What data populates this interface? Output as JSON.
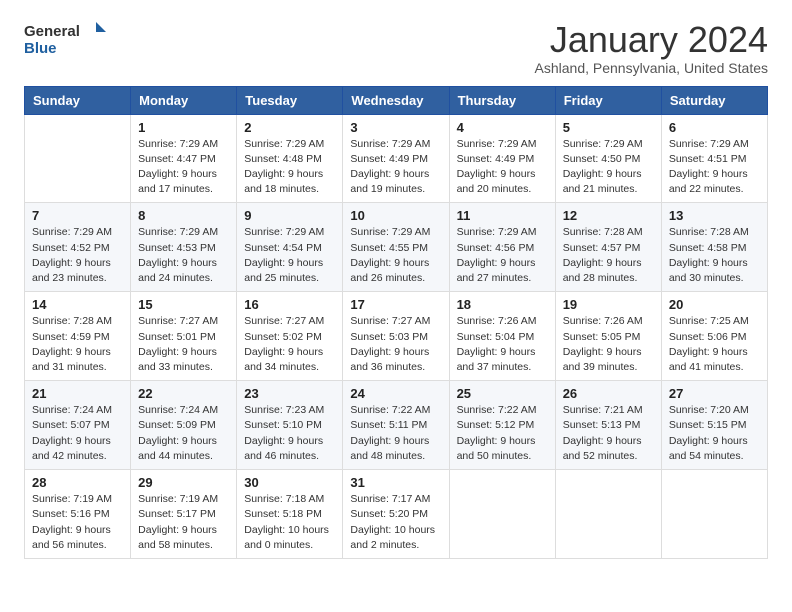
{
  "header": {
    "logo_general": "General",
    "logo_blue": "Blue",
    "month_title": "January 2024",
    "location": "Ashland, Pennsylvania, United States"
  },
  "weekdays": [
    "Sunday",
    "Monday",
    "Tuesday",
    "Wednesday",
    "Thursday",
    "Friday",
    "Saturday"
  ],
  "weeks": [
    [
      {
        "day": "",
        "info": ""
      },
      {
        "day": "1",
        "info": "Sunrise: 7:29 AM\nSunset: 4:47 PM\nDaylight: 9 hours\nand 17 minutes."
      },
      {
        "day": "2",
        "info": "Sunrise: 7:29 AM\nSunset: 4:48 PM\nDaylight: 9 hours\nand 18 minutes."
      },
      {
        "day": "3",
        "info": "Sunrise: 7:29 AM\nSunset: 4:49 PM\nDaylight: 9 hours\nand 19 minutes."
      },
      {
        "day": "4",
        "info": "Sunrise: 7:29 AM\nSunset: 4:49 PM\nDaylight: 9 hours\nand 20 minutes."
      },
      {
        "day": "5",
        "info": "Sunrise: 7:29 AM\nSunset: 4:50 PM\nDaylight: 9 hours\nand 21 minutes."
      },
      {
        "day": "6",
        "info": "Sunrise: 7:29 AM\nSunset: 4:51 PM\nDaylight: 9 hours\nand 22 minutes."
      }
    ],
    [
      {
        "day": "7",
        "info": "Sunrise: 7:29 AM\nSunset: 4:52 PM\nDaylight: 9 hours\nand 23 minutes."
      },
      {
        "day": "8",
        "info": "Sunrise: 7:29 AM\nSunset: 4:53 PM\nDaylight: 9 hours\nand 24 minutes."
      },
      {
        "day": "9",
        "info": "Sunrise: 7:29 AM\nSunset: 4:54 PM\nDaylight: 9 hours\nand 25 minutes."
      },
      {
        "day": "10",
        "info": "Sunrise: 7:29 AM\nSunset: 4:55 PM\nDaylight: 9 hours\nand 26 minutes."
      },
      {
        "day": "11",
        "info": "Sunrise: 7:29 AM\nSunset: 4:56 PM\nDaylight: 9 hours\nand 27 minutes."
      },
      {
        "day": "12",
        "info": "Sunrise: 7:28 AM\nSunset: 4:57 PM\nDaylight: 9 hours\nand 28 minutes."
      },
      {
        "day": "13",
        "info": "Sunrise: 7:28 AM\nSunset: 4:58 PM\nDaylight: 9 hours\nand 30 minutes."
      }
    ],
    [
      {
        "day": "14",
        "info": "Sunrise: 7:28 AM\nSunset: 4:59 PM\nDaylight: 9 hours\nand 31 minutes."
      },
      {
        "day": "15",
        "info": "Sunrise: 7:27 AM\nSunset: 5:01 PM\nDaylight: 9 hours\nand 33 minutes."
      },
      {
        "day": "16",
        "info": "Sunrise: 7:27 AM\nSunset: 5:02 PM\nDaylight: 9 hours\nand 34 minutes."
      },
      {
        "day": "17",
        "info": "Sunrise: 7:27 AM\nSunset: 5:03 PM\nDaylight: 9 hours\nand 36 minutes."
      },
      {
        "day": "18",
        "info": "Sunrise: 7:26 AM\nSunset: 5:04 PM\nDaylight: 9 hours\nand 37 minutes."
      },
      {
        "day": "19",
        "info": "Sunrise: 7:26 AM\nSunset: 5:05 PM\nDaylight: 9 hours\nand 39 minutes."
      },
      {
        "day": "20",
        "info": "Sunrise: 7:25 AM\nSunset: 5:06 PM\nDaylight: 9 hours\nand 41 minutes."
      }
    ],
    [
      {
        "day": "21",
        "info": "Sunrise: 7:24 AM\nSunset: 5:07 PM\nDaylight: 9 hours\nand 42 minutes."
      },
      {
        "day": "22",
        "info": "Sunrise: 7:24 AM\nSunset: 5:09 PM\nDaylight: 9 hours\nand 44 minutes."
      },
      {
        "day": "23",
        "info": "Sunrise: 7:23 AM\nSunset: 5:10 PM\nDaylight: 9 hours\nand 46 minutes."
      },
      {
        "day": "24",
        "info": "Sunrise: 7:22 AM\nSunset: 5:11 PM\nDaylight: 9 hours\nand 48 minutes."
      },
      {
        "day": "25",
        "info": "Sunrise: 7:22 AM\nSunset: 5:12 PM\nDaylight: 9 hours\nand 50 minutes."
      },
      {
        "day": "26",
        "info": "Sunrise: 7:21 AM\nSunset: 5:13 PM\nDaylight: 9 hours\nand 52 minutes."
      },
      {
        "day": "27",
        "info": "Sunrise: 7:20 AM\nSunset: 5:15 PM\nDaylight: 9 hours\nand 54 minutes."
      }
    ],
    [
      {
        "day": "28",
        "info": "Sunrise: 7:19 AM\nSunset: 5:16 PM\nDaylight: 9 hours\nand 56 minutes."
      },
      {
        "day": "29",
        "info": "Sunrise: 7:19 AM\nSunset: 5:17 PM\nDaylight: 9 hours\nand 58 minutes."
      },
      {
        "day": "30",
        "info": "Sunrise: 7:18 AM\nSunset: 5:18 PM\nDaylight: 10 hours\nand 0 minutes."
      },
      {
        "day": "31",
        "info": "Sunrise: 7:17 AM\nSunset: 5:20 PM\nDaylight: 10 hours\nand 2 minutes."
      },
      {
        "day": "",
        "info": ""
      },
      {
        "day": "",
        "info": ""
      },
      {
        "day": "",
        "info": ""
      }
    ]
  ]
}
